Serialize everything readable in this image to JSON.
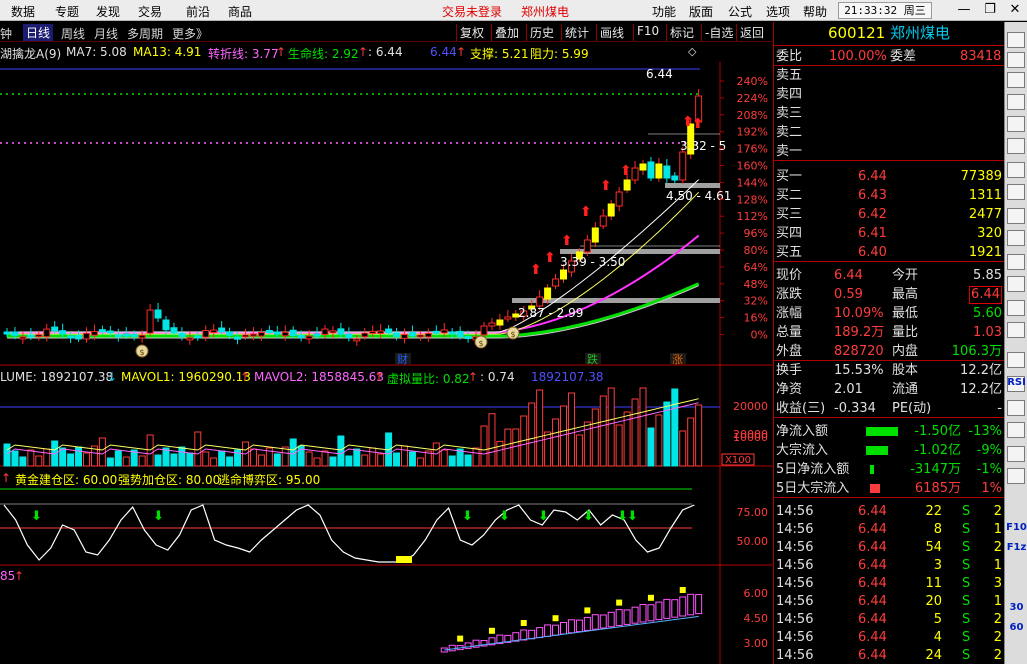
{
  "menu": {
    "items": [
      "数据",
      "专题",
      "发现",
      "交易",
      "前沿",
      "商品"
    ],
    "status_login": "交易未登录",
    "status_stock": "郑州煤电",
    "right_items": [
      "功能",
      "版面",
      "公式",
      "选项",
      "帮助"
    ],
    "clock": "21:33:32 周三"
  },
  "toolbar": {
    "period_items": [
      "分钟",
      "日线",
      "周线",
      "月线",
      "多周期",
      "更多》"
    ],
    "right_buttons": [
      "复权",
      "叠加",
      "历史",
      "统计",
      "画线",
      "F10",
      "标记",
      "-自选",
      "返回"
    ]
  },
  "main_indicator": {
    "name": "湖擒龙A(9)",
    "ma7": "MA7: 5.08",
    "ma13": "MA13: 4.91",
    "turn": "转折线: 3.77",
    "life": "生命线: 2.92",
    "v1": ": 6.44",
    "v2": "6.44",
    "support": "支撑: 5.21",
    "resist": "阻力: 5.99"
  },
  "price_axis": [
    "240%",
    "224%",
    "208%",
    "192%",
    "176%",
    "160%",
    "144%",
    "128%",
    "112%",
    "96%",
    "80%",
    "64%",
    "48%",
    "32%",
    "16%",
    "0%"
  ],
  "annotations": {
    "high": "6.44",
    "r1": "3.32 - 5",
    "r2": "4.50 - 4.61",
    "r3": "3.39 - 3.50",
    "r4": "2.87 - 2.99",
    "m1": "财",
    "m2": "跌",
    "m3": "涨"
  },
  "volume_indicator": {
    "vol": "LUME: 1892107.38",
    "vol_arrow": "↓",
    "mavol1": "MAVOL1: 1960290.13",
    "mavol1_arrow": "↑",
    "mavol2": "MAVOL2: 1858845.63",
    "mavol2_arrow": "↑",
    "ratio": "虚拟量比: 0.82",
    "ratio_arrow": "↑",
    "v": ": 0.74",
    "vv": "1892107.38",
    "axis": [
      "20000",
      "10000"
    ],
    "unit": "X100"
  },
  "kdj_indicator": {
    "a": "黄金建仓区: 60.00",
    "b": "强势加仓区: 80.00",
    "c": "逃命博弈区: 95.00",
    "axis": [
      "75.00",
      "50.00"
    ]
  },
  "macd_indicator": {
    "a": "85",
    "a_arrow": "↑",
    "axis": [
      "6.00",
      "4.50",
      "3.00"
    ]
  },
  "quote": {
    "code": "600121",
    "name": "郑州煤电",
    "wb_label": "委比",
    "wb_val": "100.00%",
    "wc_label": "委差",
    "wc_val": "83418",
    "sell": [
      {
        "l": "卖五",
        "p": "",
        "v": ""
      },
      {
        "l": "卖四",
        "p": "",
        "v": ""
      },
      {
        "l": "卖三",
        "p": "",
        "v": ""
      },
      {
        "l": "卖二",
        "p": "",
        "v": ""
      },
      {
        "l": "卖一",
        "p": "",
        "v": ""
      }
    ],
    "buy": [
      {
        "l": "买一",
        "p": "6.44",
        "v": "77389"
      },
      {
        "l": "买二",
        "p": "6.43",
        "v": "1311"
      },
      {
        "l": "买三",
        "p": "6.42",
        "v": "2477"
      },
      {
        "l": "买四",
        "p": "6.41",
        "v": "320"
      },
      {
        "l": "买五",
        "p": "6.40",
        "v": "1921"
      }
    ],
    "stats": [
      {
        "l1": "现价",
        "v1": "6.44",
        "l2": "今开",
        "v2": "5.85"
      },
      {
        "l1": "涨跌",
        "v1": "0.59",
        "l2": "最高",
        "v2": "6.44"
      },
      {
        "l1": "涨幅",
        "v1": "10.09%",
        "l2": "最低",
        "v2": "5.60"
      },
      {
        "l1": "总量",
        "v1": "189.2万",
        "l2": "量比",
        "v2": "1.03"
      },
      {
        "l1": "外盘",
        "v1": "828720",
        "l2": "内盘",
        "v2": "106.3万"
      },
      {
        "l1": "换手",
        "v1": "15.53%",
        "l2": "股本",
        "v2": "12.2亿"
      },
      {
        "l1": "净资",
        "v1": "2.01",
        "l2": "流通",
        "v2": "12.2亿"
      },
      {
        "l1": "收益(三)",
        "v1": "-0.334",
        "l2": "PE(动)",
        "v2": "-"
      }
    ],
    "flows": [
      {
        "l": "净流入额",
        "v": "-1.50亿",
        "p": "-13%"
      },
      {
        "l": "大宗流入",
        "v": "-1.02亿",
        "p": "-9%"
      },
      {
        "l": "5日净流入额",
        "v": "-3147万",
        "p": "-1%"
      },
      {
        "l": "5日大宗流入",
        "v": "6185万",
        "p": "1%"
      }
    ],
    "ticks": [
      {
        "t": "14:56",
        "p": "6.44",
        "v": "22",
        "s": "S",
        "n": "2"
      },
      {
        "t": "14:56",
        "p": "6.44",
        "v": "8",
        "s": "S",
        "n": "1"
      },
      {
        "t": "14:56",
        "p": "6.44",
        "v": "54",
        "s": "S",
        "n": "2"
      },
      {
        "t": "14:56",
        "p": "6.44",
        "v": "3",
        "s": "S",
        "n": "1"
      },
      {
        "t": "14:56",
        "p": "6.44",
        "v": "11",
        "s": "S",
        "n": "3"
      },
      {
        "t": "14:56",
        "p": "6.44",
        "v": "20",
        "s": "S",
        "n": "1"
      },
      {
        "t": "14:56",
        "p": "6.44",
        "v": "5",
        "s": "S",
        "n": "2"
      },
      {
        "t": "14:56",
        "p": "6.44",
        "v": "4",
        "s": "S",
        "n": "2"
      },
      {
        "t": "14:56",
        "p": "6.44",
        "v": "24",
        "s": "S",
        "n": "2"
      }
    ]
  },
  "sidebar": {
    "labels": [
      "RSI",
      "F10",
      "F1z",
      "30",
      "60"
    ]
  }
}
